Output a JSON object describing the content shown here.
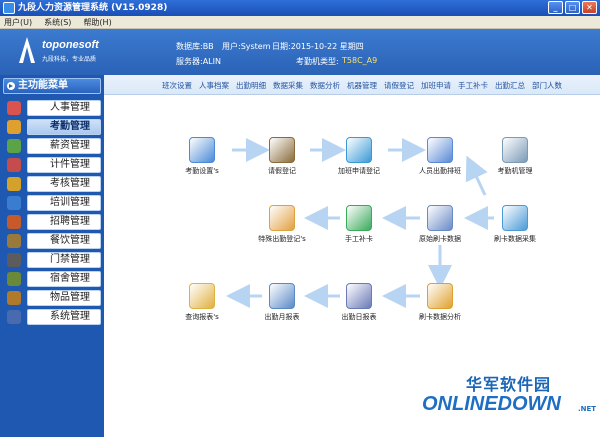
{
  "window": {
    "title": "九段人力资源管理系统 (V15.0928)"
  },
  "menu": {
    "items": [
      "用户(U)",
      "系统(S)",
      "帮助(H)"
    ]
  },
  "header": {
    "logo_text": "toponesoft",
    "logo_sub": "九段科技，专业品质",
    "database": "数据库:BB",
    "user": "用户:System",
    "date": "日期:2015-10-22  星期四",
    "server": "服务器:ALIN",
    "device_type_label": "考勤机类型:",
    "device_type": "T58C_A9",
    "device_color": "#ffe25a"
  },
  "sidebar": {
    "title": "主功能菜单",
    "items": [
      {
        "label": "人事管理",
        "icon": "people-icon",
        "color": "#d9534f"
      },
      {
        "label": "考勤管理",
        "icon": "clock-icon",
        "color": "#e0a030"
      },
      {
        "label": "薪资管理",
        "icon": "money-icon",
        "color": "#5aa346"
      },
      {
        "label": "计件管理",
        "icon": "piece-icon",
        "color": "#c44c4c"
      },
      {
        "label": "考核管理",
        "icon": "appraisal-icon",
        "color": "#d4a12a"
      },
      {
        "label": "培训管理",
        "icon": "training-icon",
        "color": "#3a7dd0"
      },
      {
        "label": "招聘管理",
        "icon": "recruit-icon",
        "color": "#c75a2a"
      },
      {
        "label": "餐饮管理",
        "icon": "dining-icon",
        "color": "#9a7a3a"
      },
      {
        "label": "门禁管理",
        "icon": "door-icon",
        "color": "#5c5c5c"
      },
      {
        "label": "宿舍管理",
        "icon": "dorm-icon",
        "color": "#6a8a3a"
      },
      {
        "label": "物品管理",
        "icon": "goods-icon",
        "color": "#b07a2a"
      },
      {
        "label": "系统管理",
        "icon": "system-icon",
        "color": "#4a6ab0"
      }
    ],
    "active_index": 1
  },
  "tabs": [
    "班次设置",
    "人事档案",
    "出勤明细",
    "数据采集",
    "数据分析",
    "机器管理",
    "请假登记",
    "加班申请",
    "手工补卡",
    "出勤汇总",
    "部门人数"
  ],
  "flow": {
    "nodes": [
      {
        "id": "shift",
        "label": "考勤设置's",
        "icon": "shift-setting-icon",
        "color": "#4a8ad6"
      },
      {
        "id": "leave",
        "label": "请假登记",
        "icon": "leave-register-icon",
        "color": "#8a6a3a"
      },
      {
        "id": "overtime",
        "label": "加班申请登记",
        "icon": "overtime-icon",
        "color": "#3a9ad6"
      },
      {
        "id": "schedule",
        "label": "人员出勤排班",
        "icon": "schedule-icon",
        "color": "#5a8ad6"
      },
      {
        "id": "machine",
        "label": "考勤机管理",
        "icon": "attendance-machine-icon",
        "color": "#7a9ab6"
      },
      {
        "id": "special",
        "label": "特殊出勤登记's",
        "icon": "special-register-icon",
        "color": "#e0a040"
      },
      {
        "id": "manual",
        "label": "手工补卡",
        "icon": "manual-card-icon",
        "color": "#3aaa5a"
      },
      {
        "id": "raw",
        "label": "原始刷卡数据",
        "icon": "raw-data-icon",
        "color": "#6a8ac6"
      },
      {
        "id": "collect",
        "label": "刷卡数据采集",
        "icon": "data-collect-icon",
        "color": "#4a9ad6"
      },
      {
        "id": "query",
        "label": "查询报表's",
        "icon": "query-report-icon",
        "color": "#e0b040"
      },
      {
        "id": "monthly",
        "label": "出勤月报表",
        "icon": "monthly-report-icon",
        "color": "#5a8ac6"
      },
      {
        "id": "daily",
        "label": "出勤日报表",
        "icon": "daily-report-icon",
        "color": "#6a7ab6"
      },
      {
        "id": "analysis",
        "label": "刷卡数据分析",
        "icon": "data-analysis-icon",
        "color": "#e0a030"
      }
    ]
  },
  "watermark": {
    "top": "华军软件园",
    "bottom": "ONLINEDOWN",
    "suffix": ".NET"
  }
}
